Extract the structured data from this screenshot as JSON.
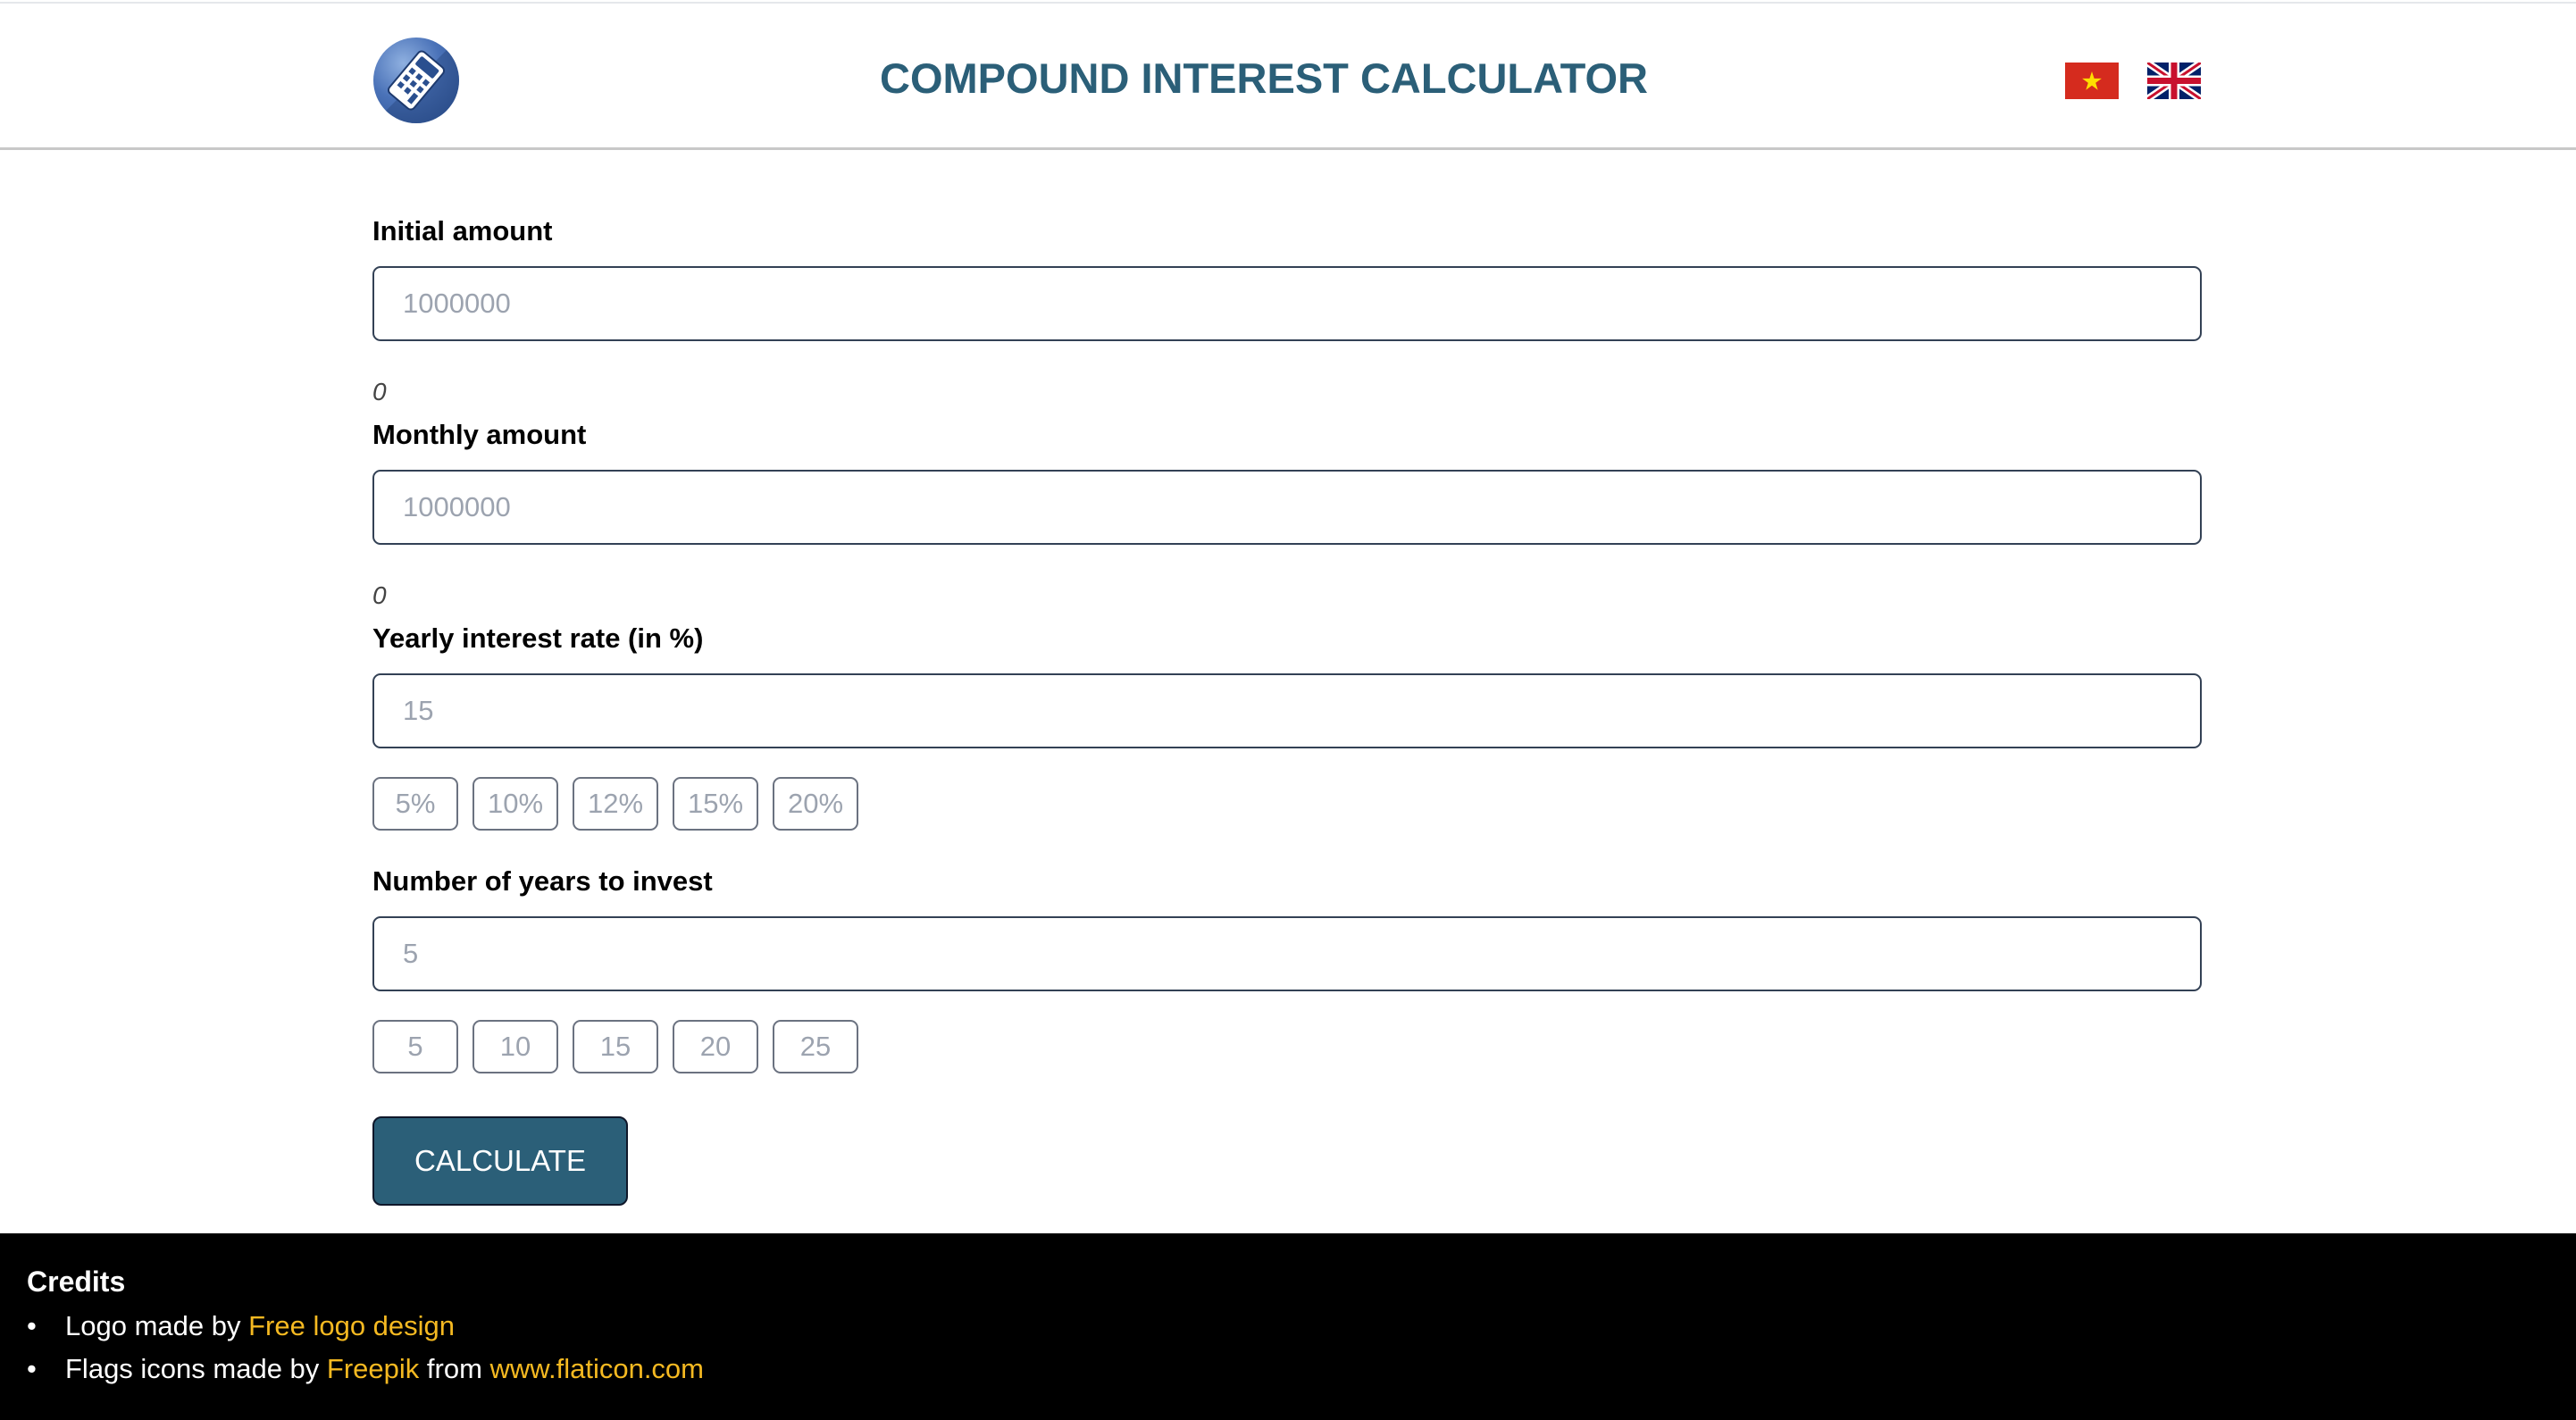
{
  "header": {
    "title": "COMPOUND INTEREST CALCULATOR",
    "logo_icon": "calculator-icon",
    "flags": [
      {
        "icon": "vietnam-flag-icon",
        "language": "Vietnamese"
      },
      {
        "icon": "uk-flag-icon",
        "language": "English"
      }
    ]
  },
  "form": {
    "initial_amount": {
      "label": "Initial amount",
      "value": "",
      "placeholder": "1000000",
      "hint": "0"
    },
    "monthly_amount": {
      "label": "Monthly amount",
      "value": "",
      "placeholder": "1000000",
      "hint": "0"
    },
    "interest_rate": {
      "label": "Yearly interest rate (in %)",
      "value": "",
      "placeholder": "15",
      "presets": [
        "5%",
        "10%",
        "12%",
        "15%",
        "20%"
      ]
    },
    "years": {
      "label": "Number of years to invest",
      "value": "",
      "placeholder": "5",
      "presets": [
        "5",
        "10",
        "15",
        "20",
        "25"
      ]
    },
    "calculate_label": "CALCULATE"
  },
  "footer": {
    "title": "Credits",
    "line1": {
      "prefix": "Logo made by ",
      "link": "Free logo design"
    },
    "line2": {
      "prefix": "Flags icons made by ",
      "link1": "Freepik",
      "middle": " from ",
      "link2": "www.flaticon.com"
    },
    "bullet": "•"
  },
  "colors": {
    "accent": "#2b5f78",
    "link": "#f5b921",
    "footer_bg": "#000000"
  }
}
